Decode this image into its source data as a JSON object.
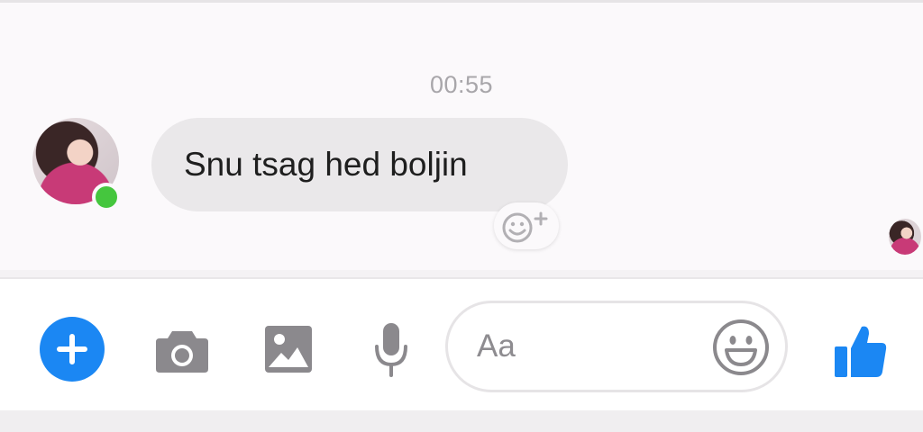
{
  "conversation": {
    "timestamp": "00:55",
    "messages": [
      {
        "sender": "contact",
        "text": "Snu tsag hed boljin"
      }
    ]
  },
  "contact": {
    "avatar_icon": "profile-photo",
    "status": "online",
    "status_color": "#45c63e"
  },
  "composer": {
    "placeholder": "Aa",
    "icons": {
      "add": "plus-icon",
      "camera": "camera-icon",
      "gallery": "image-icon",
      "voice": "microphone-icon",
      "emoji": "smiley-icon",
      "send_like": "thumbs-up-icon"
    },
    "accent_color": "#1b87f3"
  }
}
